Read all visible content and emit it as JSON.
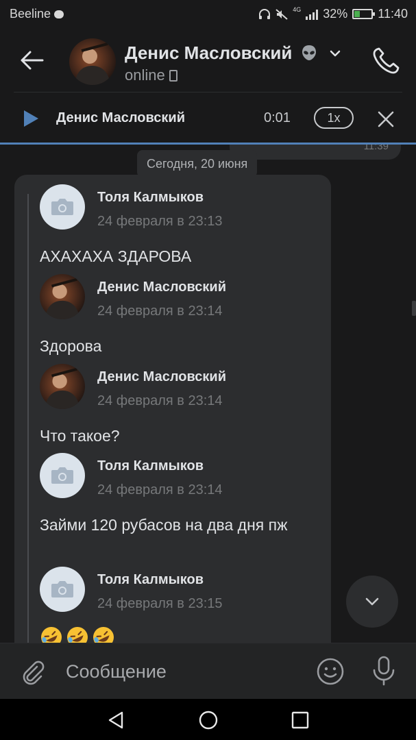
{
  "status_bar": {
    "carrier": "Beeline",
    "network": "4G",
    "battery": "32%",
    "battery_level": 0.32,
    "time": "11:40"
  },
  "header": {
    "contact_name": "Денис Масловский",
    "status": "online"
  },
  "audio_player": {
    "title": "Денис Масловский",
    "time": "0:01",
    "speed": "1x"
  },
  "chat": {
    "previous_message_time": "11:39",
    "date_separator": "Сегодня, 20 июня",
    "forwarded": [
      {
        "author": "Толя Калмыков",
        "date": "24 февраля в 23:13",
        "text": "АХАХАХА ЗДАРОВА",
        "avatar": "camera-placeholder"
      },
      {
        "author": "Денис Масловский",
        "date": "24 февраля в 23:14",
        "text": "Здорова",
        "avatar": "photo"
      },
      {
        "author": "Денис Масловский",
        "date": "24 февраля в 23:14",
        "text": "Что такое?",
        "avatar": "photo"
      },
      {
        "author": "Толя Калмыков",
        "date": "24 февраля в 23:14",
        "text": "Займи 120 рубасов на два дня пж",
        "avatar": "camera-placeholder"
      },
      {
        "author": "Толя Калмыков",
        "date": "24 февраля в 23:15",
        "text": "",
        "emojis": [
          "rolling-on-floor-laughing",
          "rolling-on-floor-laughing",
          "rolling-on-floor-laughing"
        ],
        "avatar": "camera-placeholder"
      }
    ]
  },
  "composer": {
    "placeholder": "Сообщение"
  },
  "colors": {
    "background": "#19191a",
    "bubble": "#2c2d2f",
    "accent": "#5181b8",
    "text_primary": "#e1e3e6",
    "text_secondary": "#76787a"
  },
  "icons": [
    "back-arrow-icon",
    "alien-icon",
    "chevron-down-icon",
    "phone-icon",
    "play-icon",
    "close-icon",
    "camera-icon",
    "attach-icon",
    "sticker-icon",
    "mic-icon",
    "nav-back-icon",
    "nav-home-icon",
    "nav-recents-icon"
  ]
}
